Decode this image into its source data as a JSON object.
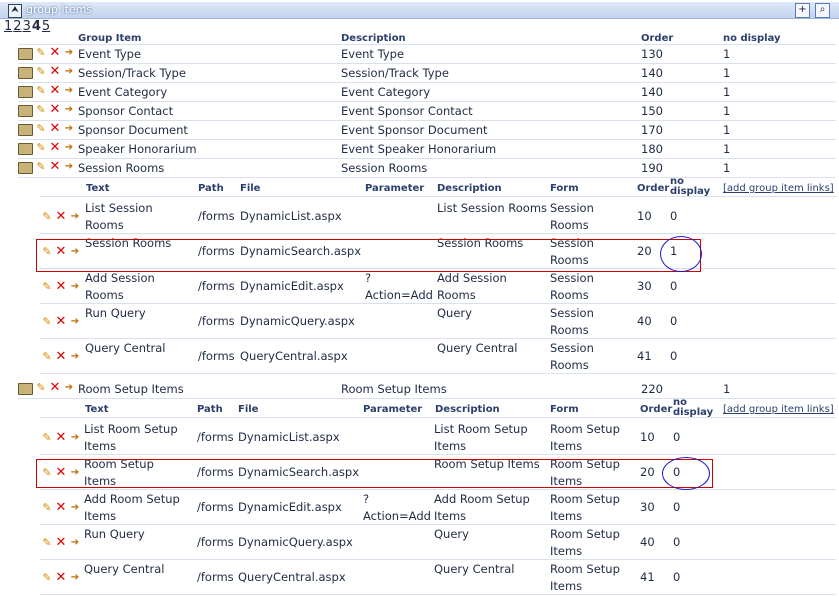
{
  "titlebar": {
    "title": "group items",
    "collapse_glyph": "⮝",
    "add_glyph": "+",
    "search_glyph": "⌕"
  },
  "pager": {
    "pages": [
      "1",
      "2",
      "3"
    ],
    "current": "4",
    "last": "5"
  },
  "groups_header": {
    "group_item": "Group Item",
    "description": "Description",
    "order": "Order",
    "no_display": "no display"
  },
  "groups": [
    {
      "name": "Event Type",
      "description": "Event Type",
      "order": "130",
      "no_display": "1"
    },
    {
      "name": "Session/Track Type",
      "description": "Session/Track Type",
      "order": "140",
      "no_display": "1"
    },
    {
      "name": "Event Category",
      "description": "Event Category",
      "order": "140",
      "no_display": "1"
    },
    {
      "name": "Sponsor Contact",
      "description": "Event Sponsor Contact",
      "order": "150",
      "no_display": "1"
    },
    {
      "name": "Sponsor Document",
      "description": "Event Sponsor Document",
      "order": "170",
      "no_display": "1"
    },
    {
      "name": "Speaker Honorarium",
      "description": "Event Speaker Honorarium",
      "order": "180",
      "no_display": "1"
    },
    {
      "name": "Session Rooms",
      "description": "Session Rooms",
      "order": "190",
      "no_display": "1"
    }
  ],
  "sub_header": {
    "text": "Text",
    "path": "Path",
    "file": "File",
    "parameter": "Parameter",
    "description": "Description",
    "form": "Form",
    "order": "Order",
    "no_display": "no display",
    "add_link": "[add group item links]"
  },
  "session_items": [
    {
      "text": "List Session Rooms",
      "path": "/forms",
      "file": "DynamicList.aspx",
      "parameter": "",
      "description": "List Session Rooms",
      "form": "Session Rooms",
      "order": "10",
      "no_display": "0"
    },
    {
      "text": "Session Rooms",
      "path": "/forms",
      "file": "DynamicSearch.aspx",
      "parameter": "",
      "description": "Session Rooms",
      "form": "Session Rooms",
      "order": "20",
      "no_display": "1"
    },
    {
      "text": "Add Session Rooms",
      "path": "/forms",
      "file": "DynamicEdit.aspx",
      "parameter": "?Action=Add",
      "description": "Add Session Rooms",
      "form": "Session Rooms",
      "order": "30",
      "no_display": "0"
    },
    {
      "text": "Run Query",
      "path": "/forms",
      "file": "DynamicQuery.aspx",
      "parameter": "",
      "description": "Query",
      "form": "Session Rooms",
      "order": "40",
      "no_display": "0"
    },
    {
      "text": "Query Central",
      "path": "/forms",
      "file": "QueryCentral.aspx",
      "parameter": "",
      "description": "Query Central",
      "form": "Session Rooms",
      "order": "41",
      "no_display": "0"
    }
  ],
  "room_group": {
    "name": "Room Setup Items",
    "description": "Room Setup Items",
    "order": "220",
    "no_display": "1"
  },
  "room_items": [
    {
      "text": "List Room Setup Items",
      "path": "/forms",
      "file": "DynamicList.aspx",
      "parameter": "",
      "description": "List Room Setup Items",
      "form": "Room Setup Items",
      "order": "10",
      "no_display": "0"
    },
    {
      "text": "Room Setup Items",
      "path": "/forms",
      "file": "DynamicSearch.aspx",
      "parameter": "",
      "description": "Room Setup Items",
      "form": "Room Setup Items",
      "order": "20",
      "no_display": "0"
    },
    {
      "text": "Add Room Setup Items",
      "path": "/forms",
      "file": "DynamicEdit.aspx",
      "parameter": "?Action=Add",
      "description": "Add Room Setup Items",
      "form": "Room Setup Items",
      "order": "30",
      "no_display": "0"
    },
    {
      "text": "Run Query",
      "path": "/forms",
      "file": "DynamicQuery.aspx",
      "parameter": "",
      "description": "Query",
      "form": "Room Setup Items",
      "order": "40",
      "no_display": "0"
    },
    {
      "text": "Query Central",
      "path": "/forms",
      "file": "QueryCentral.aspx",
      "parameter": "",
      "description": "Query Central",
      "form": "Room Setup Items",
      "order": "41",
      "no_display": "0"
    }
  ],
  "icons": {
    "folder": "folder-icon",
    "edit": "pencil-icon",
    "delete": "delete-icon",
    "move": "arrow-icon"
  },
  "colors": {
    "annotation_box": "#d20000",
    "annotation_circle": "#1a1ac8",
    "titlebar": "#c3d3ee"
  }
}
